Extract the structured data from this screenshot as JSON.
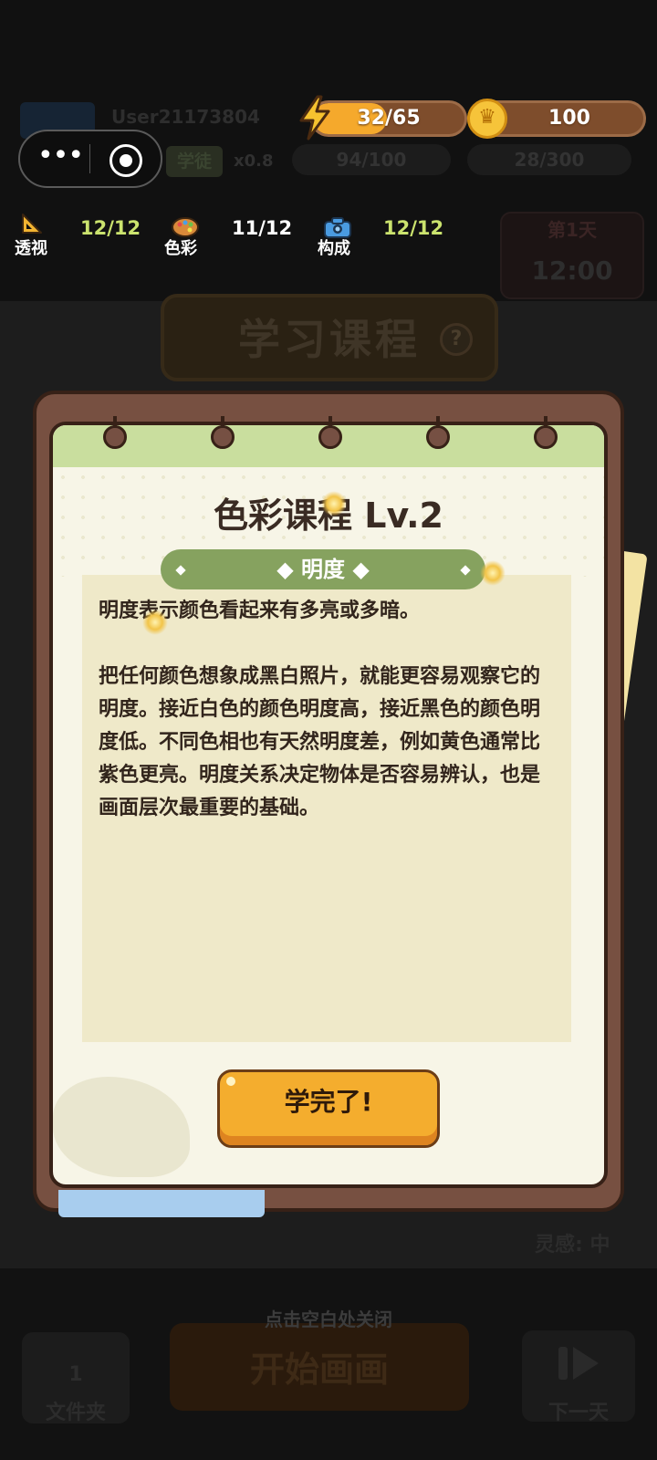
{
  "hud": {
    "energy": {
      "text": "32/65",
      "fraction": 0.49,
      "fill_color": "#f5a92c"
    },
    "coins": {
      "text": "100"
    }
  },
  "capsule": {
    "more_icon": "more-dots-icon",
    "target_icon": "target-circle-icon"
  },
  "skills": [
    {
      "label": "透视",
      "value": "12/12",
      "icon": "ruler-triangle-icon",
      "value_color": "#cbe36e"
    },
    {
      "label": "色彩",
      "value": "11/12",
      "icon": "palette-icon",
      "value_color": "#ffffff"
    },
    {
      "label": "构成",
      "value": "12/12",
      "icon": "camera-icon",
      "value_color": "#cbe36e"
    }
  ],
  "background": {
    "username": "User21173804",
    "rank": "学徒",
    "multiplier": "x0.8",
    "stat1": "94/100",
    "stat2": "28/300",
    "day": "第1天",
    "time": "12:00",
    "course_banner": "学习课程",
    "help_icon": "?",
    "inspiration": "灵感: 中",
    "close_hint": "点击空白处关闭",
    "start_button": "开始画画",
    "folder_count": "1",
    "folder_label": "文件夹",
    "next_day_label": "下一天"
  },
  "modal": {
    "title": "色彩课程 Lv.2",
    "topic": "明度",
    "paragraphs": [
      "明度表示颜色看起来有多亮或多暗。",
      "把任何颜色想象成黑白照片，就能更容易观察它的明度。接近白色的颜色明度高，接近黑色的颜色明度低。不同色相也有天然明度差，例如黄色通常比紫色更亮。明度关系决定物体是否容易辨认，也是画面层次最重要的基础。"
    ],
    "finish_button": "学完了!"
  },
  "colors": {
    "accent_orange": "#f4ad2e",
    "topic_green": "#86a25f",
    "frame_brown": "#775041"
  }
}
